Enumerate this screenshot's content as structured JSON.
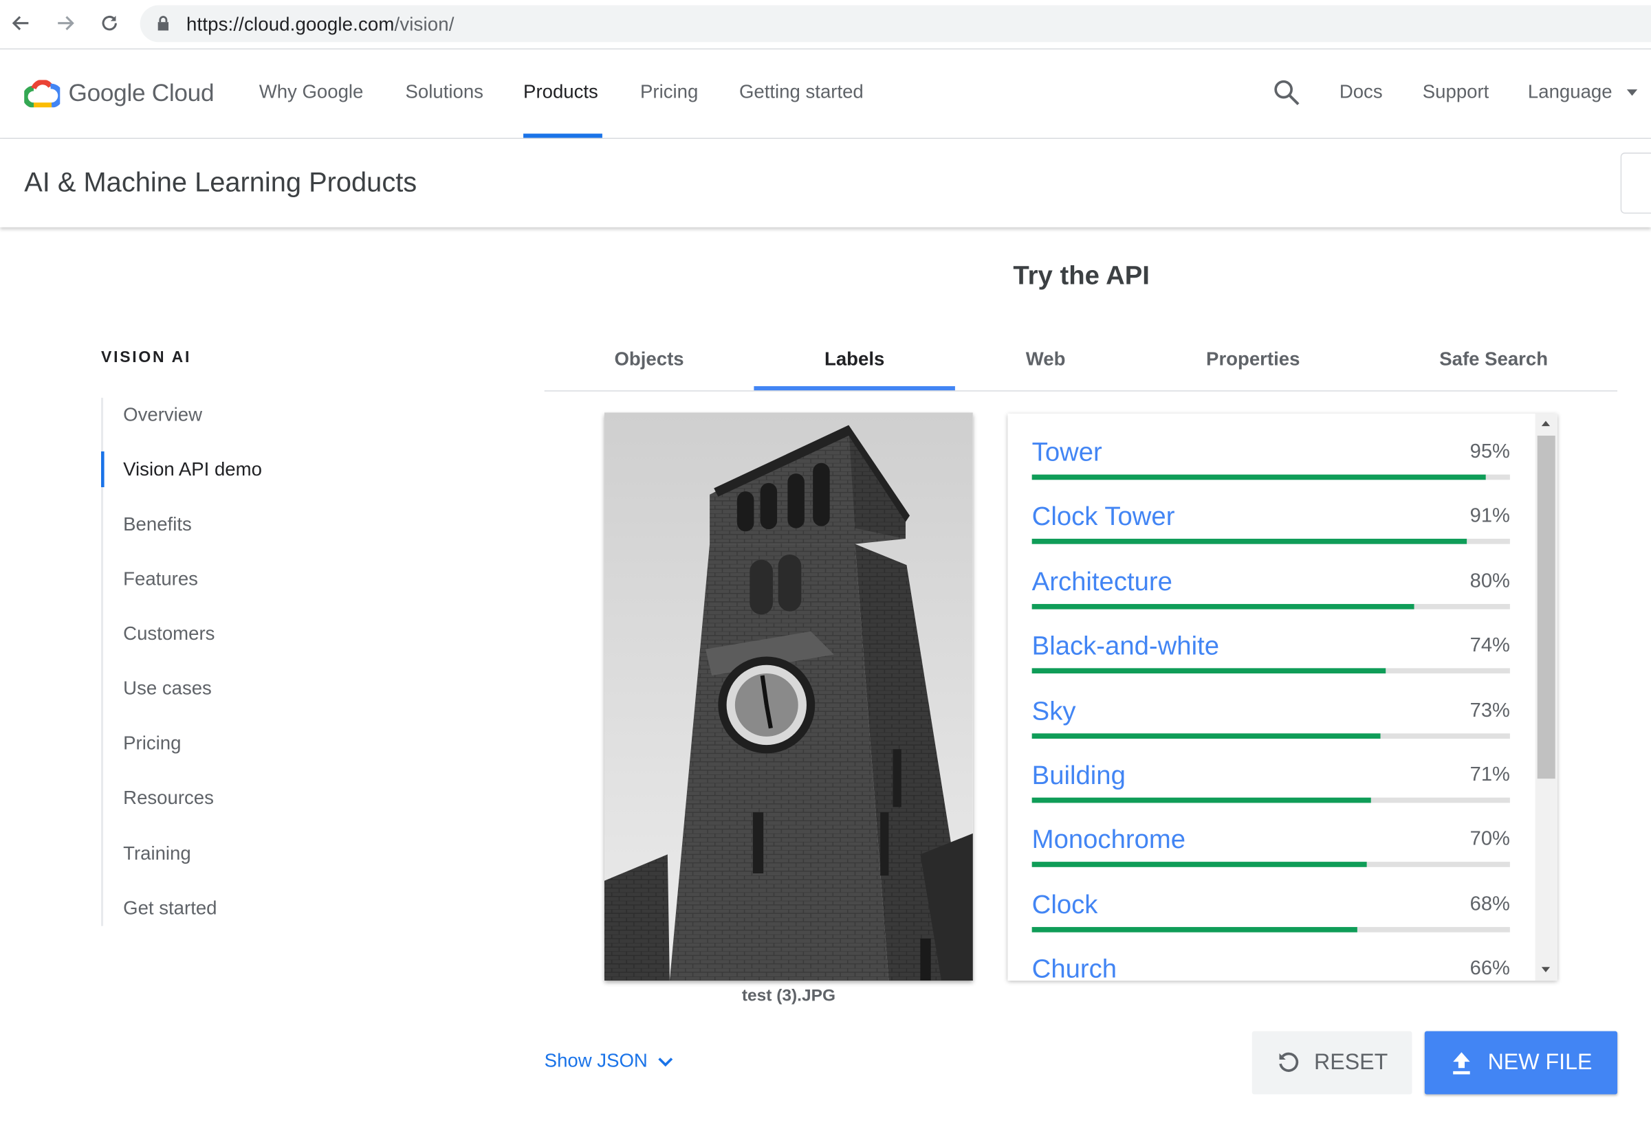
{
  "browser": {
    "url_host": "https://cloud.google.com",
    "url_path": "/vision/"
  },
  "topnav": {
    "logo_text": "Google Cloud",
    "items": [
      "Why Google",
      "Solutions",
      "Products",
      "Pricing",
      "Getting started"
    ],
    "active_item": "Products",
    "right_items": [
      "Docs",
      "Support",
      "Language"
    ]
  },
  "product_header": {
    "title": "AI & Machine Learning Products"
  },
  "sidebar": {
    "heading": "VISION AI",
    "items": [
      "Overview",
      "Vision API demo",
      "Benefits",
      "Features",
      "Customers",
      "Use cases",
      "Pricing",
      "Resources",
      "Training",
      "Get started"
    ],
    "active_item": "Vision API demo"
  },
  "main": {
    "title": "Try the API",
    "tabs": [
      "Objects",
      "Labels",
      "Web",
      "Properties",
      "Safe Search"
    ],
    "active_tab": "Labels",
    "image_caption": "test (3).JPG",
    "labels": [
      {
        "label": "Tower",
        "score": "95%",
        "value": 0.95
      },
      {
        "label": "Clock Tower",
        "score": "91%",
        "value": 0.91
      },
      {
        "label": "Architecture",
        "score": "80%",
        "value": 0.8
      },
      {
        "label": "Black-and-white",
        "score": "74%",
        "value": 0.74
      },
      {
        "label": "Sky",
        "score": "73%",
        "value": 0.73
      },
      {
        "label": "Building",
        "score": "71%",
        "value": 0.71
      },
      {
        "label": "Monochrome",
        "score": "70%",
        "value": 0.7
      },
      {
        "label": "Clock",
        "score": "68%",
        "value": 0.68
      },
      {
        "label": "Church",
        "score": "66%",
        "value": 0.66
      }
    ],
    "show_json_label": "Show JSON",
    "reset_label": "RESET",
    "new_file_label": "NEW FILE"
  },
  "colors": {
    "accent": "#4285f4",
    "link": "#1a73e8",
    "bar_fill": "#0f9d58"
  }
}
